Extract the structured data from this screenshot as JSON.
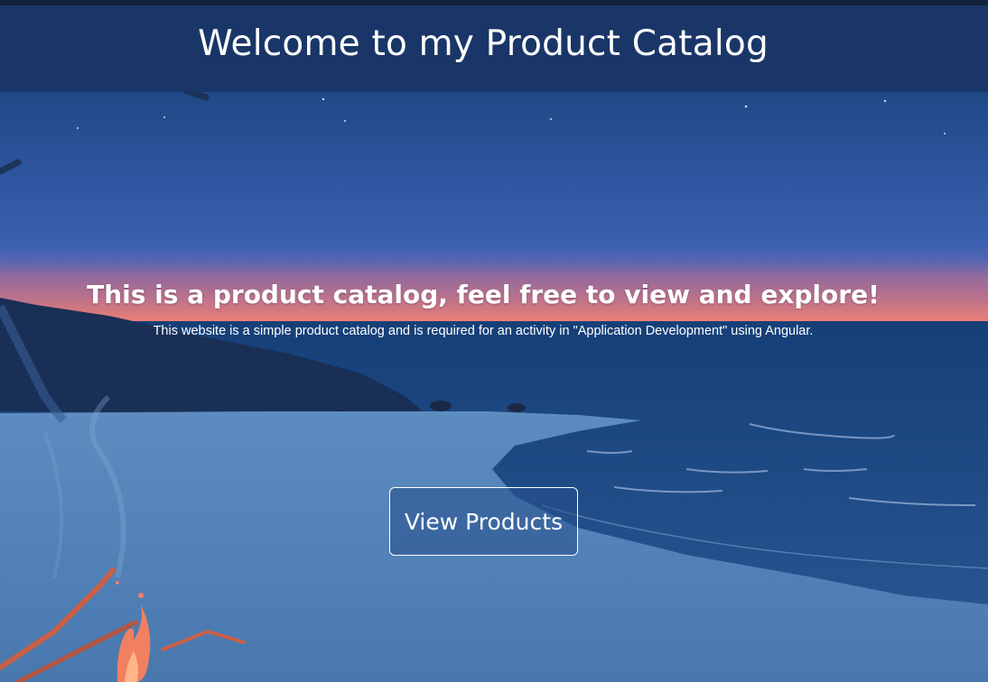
{
  "header": {
    "title": "Welcome to my Product Catalog"
  },
  "hero": {
    "heading": "This is a product catalog, feel free to view and explore!",
    "subtext": "This website is a simple product catalog and is required for an activity in \"Application Development\" using Angular.",
    "button_label": "View Products"
  },
  "colors": {
    "header_bg": "#1a3668",
    "sky": "#143a6b",
    "sunset_glow": "#f07e6e",
    "sand": "#4f7fb5",
    "sea": "#1d4a86",
    "fire": "#f0765a"
  }
}
